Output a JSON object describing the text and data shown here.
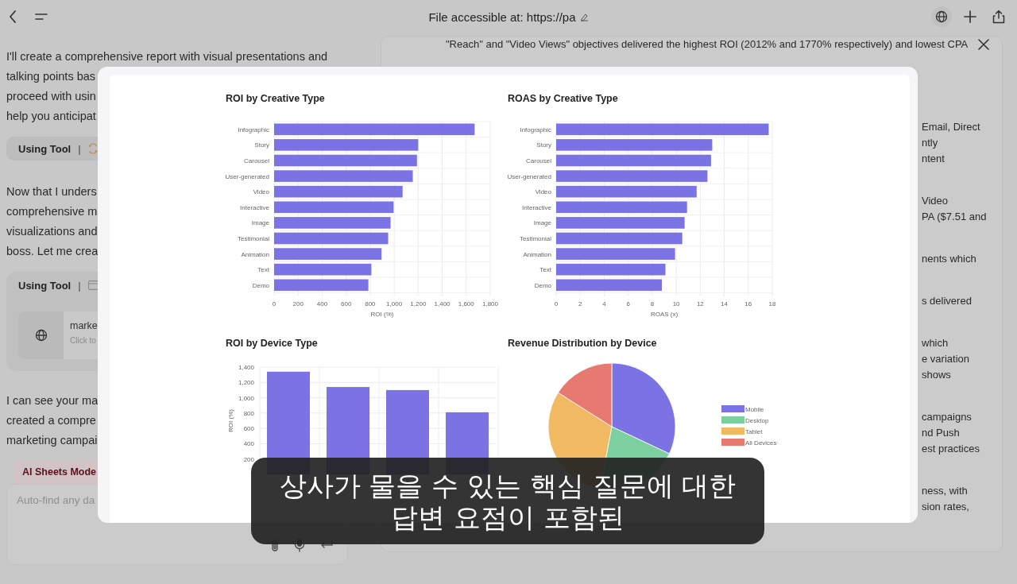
{
  "top_bar": {
    "title": "File accessible at: https://pa"
  },
  "chat": {
    "blocks": [
      {
        "kind": "text",
        "lines": [
          "I'll create a comprehensive report with visual presentations and",
          "talking points bas",
          "proceed with usin",
          "help you anticipat"
        ]
      },
      {
        "kind": "tool",
        "label": "Using Tool",
        "separator": "|"
      },
      {
        "kind": "text",
        "lines": [
          "Now that I unders",
          "comprehensive m",
          "visualizations and",
          "boss. Let me crea"
        ]
      },
      {
        "kind": "tool_card",
        "label": "Using Tool",
        "separator": "|",
        "file_name": "marke",
        "hint": "Click to"
      },
      {
        "kind": "text",
        "lines": [
          "I can see your ma",
          "created a compre",
          "marketing campai"
        ]
      }
    ],
    "mode_tab": "AI Sheets Mode",
    "input": {
      "placeholder": "Auto-find any da"
    }
  },
  "panel": {
    "top_line": "\"Reach\" and \"Video Views\" objectives delivered the highest ROI (2012% and 1770% respectively) and lowest CPA",
    "paragraphs": [
      [
        "Email, Direct",
        "ntly",
        "ntent"
      ],
      [
        "Video",
        "PA ($7.51 and"
      ],
      [
        "nents which"
      ],
      [
        "s delivered"
      ],
      [
        "which",
        "e variation",
        "shows"
      ],
      [
        "campaigns",
        "nd Push",
        "est practices"
      ],
      [
        "ness, with",
        "sion rates,"
      ]
    ]
  },
  "modal": {
    "charts": [
      {
        "title": "ROI by Creative Type",
        "chart_data": {
          "type": "bar",
          "orientation": "horizontal",
          "grid": true,
          "xlabel": "ROI (%)",
          "categories": [
            "Infographic",
            "Story",
            "Carousel",
            "User-generated",
            "Video",
            "Interactive",
            "Image",
            "Testimonial",
            "Animation",
            "Text",
            "Demo"
          ],
          "values": [
            1670,
            1200,
            1190,
            1155,
            1070,
            995,
            970,
            950,
            895,
            810,
            785
          ],
          "xlim": [
            0,
            1800
          ],
          "xticks": [
            0,
            200,
            400,
            600,
            800,
            {
              "value": 1000,
              "label": "1,000"
            },
            {
              "value": 1200,
              "label": "1,200"
            },
            {
              "value": 1400,
              "label": "1,400"
            },
            {
              "value": 1600,
              "label": "1,600"
            },
            {
              "value": 1800,
              "label": "1,800"
            }
          ]
        }
      },
      {
        "title": "ROAS by Creative Type",
        "chart_data": {
          "type": "bar",
          "orientation": "horizontal",
          "grid": true,
          "xlabel": "ROAS (x)",
          "categories": [
            "Infographic",
            "Story",
            "Carousel",
            "User-generated",
            "Video",
            "Interactive",
            "Image",
            "Testimonial",
            "Animation",
            "Text",
            "Demo"
          ],
          "values": [
            17.7,
            13,
            12.9,
            12.6,
            11.7,
            10.9,
            10.7,
            10.5,
            9.9,
            9.1,
            8.8
          ],
          "xlim": [
            0,
            18
          ],
          "xticks": [
            0,
            2,
            4,
            6,
            8,
            10,
            12,
            14,
            16,
            18
          ]
        }
      },
      {
        "title": "ROI by Device Type",
        "chart_data": {
          "type": "bar",
          "orientation": "vertical",
          "grid": true,
          "ylabel": "ROI (%)",
          "values": [
            1340,
            1140,
            1100,
            810
          ],
          "ylim": [
            0,
            1400
          ],
          "yticks": [
            200,
            400,
            600,
            800,
            {
              "value": 1000,
              "label": "1,000"
            },
            {
              "value": 1200,
              "label": "1,200"
            },
            {
              "value": 1400,
              "label": "1,400"
            }
          ]
        }
      },
      {
        "title": "Revenue Distribution by Device",
        "legend": [
          {
            "label": "Mobile",
            "color": "#7b73e4"
          },
          {
            "label": "Desktop",
            "color": "#7ccf9e"
          },
          {
            "label": "Tablet",
            "color": "#f0b962"
          },
          {
            "label": "All Devices",
            "color": "#e77a70"
          }
        ]
      }
    ]
  },
  "subtitle": {
    "lines": [
      "상사가 물을 수 있는 핵심 질문에 대한",
      "답변 요점이 포함된"
    ]
  }
}
